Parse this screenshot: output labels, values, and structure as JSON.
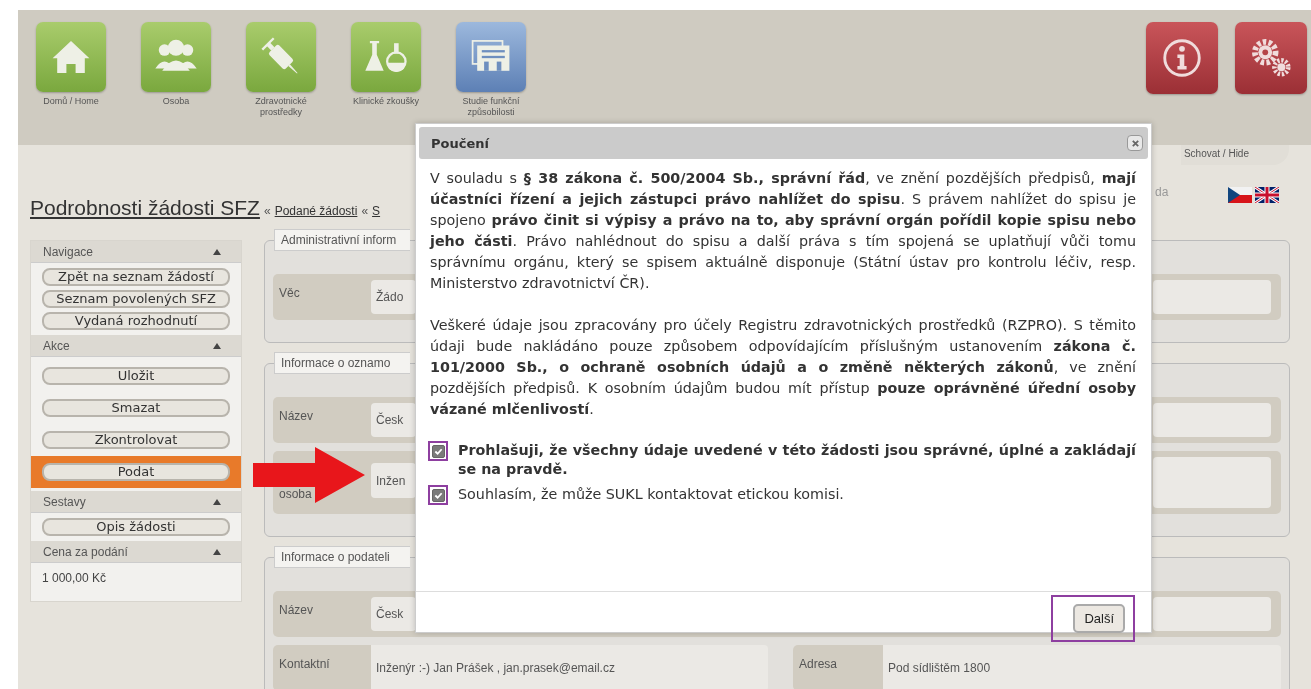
{
  "nav": [
    {
      "label": "Domů / Home",
      "selected": false
    },
    {
      "label": "Osoba",
      "selected": false
    },
    {
      "label": "Zdravotnické prostředky",
      "selected": false
    },
    {
      "label": "Klinické zkoušky",
      "selected": false
    },
    {
      "label": "Studie funkční způsobilosti",
      "selected": true
    }
  ],
  "top_actions": [
    {
      "kind": "info"
    },
    {
      "kind": "settings"
    }
  ],
  "hide_tab": "Schovat / Hide",
  "header_fragment": "da",
  "languages": [
    {
      "kind": "cz"
    },
    {
      "kind": "en"
    }
  ],
  "page_title": "Podrobnosti žádosti SFZ",
  "breadcrumbs": [
    {
      "separator": "«",
      "label": "Podané žádosti"
    },
    {
      "separator": "«",
      "label": "S"
    }
  ],
  "sidebar": [
    {
      "title": "Navigace",
      "expanded": true,
      "items": [
        {
          "kind": "link",
          "label": "Zpět na seznam žádostí",
          "highlighted": false
        },
        {
          "kind": "link",
          "label": "Seznam povolených SFZ",
          "highlighted": false
        },
        {
          "kind": "link",
          "label": "Vydaná rozhodnutí",
          "highlighted": false
        }
      ]
    },
    {
      "title": "Akce",
      "expanded": true,
      "items": [
        {
          "kind": "button",
          "label": "Uložit",
          "highlighted": false
        },
        {
          "kind": "button",
          "label": "Smazat",
          "highlighted": false
        },
        {
          "kind": "button",
          "label": "Zkontrolovat",
          "highlighted": false
        },
        {
          "kind": "button",
          "label": "Podat",
          "highlighted": true
        }
      ]
    },
    {
      "title": "Sestavy",
      "expanded": true,
      "items": [
        {
          "kind": "link",
          "label": "Opis žádosti",
          "highlighted": false
        }
      ]
    },
    {
      "title": "Cena za podání",
      "expanded": true,
      "items": [
        {
          "kind": "text",
          "label": "1 000,00 Kč",
          "highlighted": false
        }
      ]
    }
  ],
  "sections": [
    {
      "legend": "Administrativní inform",
      "rows": [
        {
          "kind": "split",
          "label": "Věc",
          "value": "Žádo"
        }
      ]
    },
    {
      "legend": "Informace o oznamo",
      "rows": [
        {
          "kind": "split",
          "label": "Název",
          "value": "Česk"
        },
        {
          "kind": "split_tall",
          "label": "osoba",
          "value": "Inžen"
        }
      ]
    },
    {
      "legend": "Informace o podateli",
      "rows": [
        {
          "kind": "split",
          "label": "Název",
          "value": "Česk"
        },
        {
          "kind": "full",
          "cells": [
            {
              "label": "Kontaktní",
              "value": "Inženýr :-) Jan Prášek , jan.prasek@email.cz"
            },
            {
              "label": "Adresa",
              "value": "Pod sídlištěm 1800"
            }
          ]
        }
      ]
    }
  ],
  "modal": {
    "title": "Poučení",
    "paragraphs": [
      "V souladu s **§ 38 zákona č. 500/2004 Sb., správní řád**, ve znění pozdějších předpisů, **mají účastníci řízení a jejich zástupci právo nahlížet do spisu**. S právem nahlížet do spisu je spojeno **právo činit si výpisy a právo na to, aby správní orgán pořídil kopie spisu nebo jeho části**. Právo nahlédnout do spisu a další práva s tím spojená se uplatňují vůči tomu správnímu orgánu, který se spisem aktuálně disponuje (Státní ústav pro kontrolu léčiv, resp. Ministerstvo zdravotnictví ČR).",
      "Veškeré údaje jsou zpracovány pro účely Registru zdravotnických prostředků (RZPRO). S těmito údaji bude nakládáno pouze způsobem odpovídajícím příslušným ustanovením **zákona č. 101/2000 Sb., o ochraně osobních údajů a o změně některých zákonů**, ve znění pozdějších předpisů. K osobním údajům budou mít přístup **pouze oprávněné úřední osoby vázané mlčenlivostí**."
    ],
    "confirmations": [
      {
        "text": "Prohlašuji, že všechny údaje uvedené v této žádosti jsou správné, úplné a zakládají se na pravdě.",
        "bold": true,
        "checked": true,
        "highlighted": true
      },
      {
        "text": "Souhlasím, že může SUKL kontaktovat etickou komisi.",
        "bold": false,
        "checked": true,
        "highlighted": true
      }
    ],
    "button": {
      "label": "Další",
      "highlighted": true
    }
  }
}
